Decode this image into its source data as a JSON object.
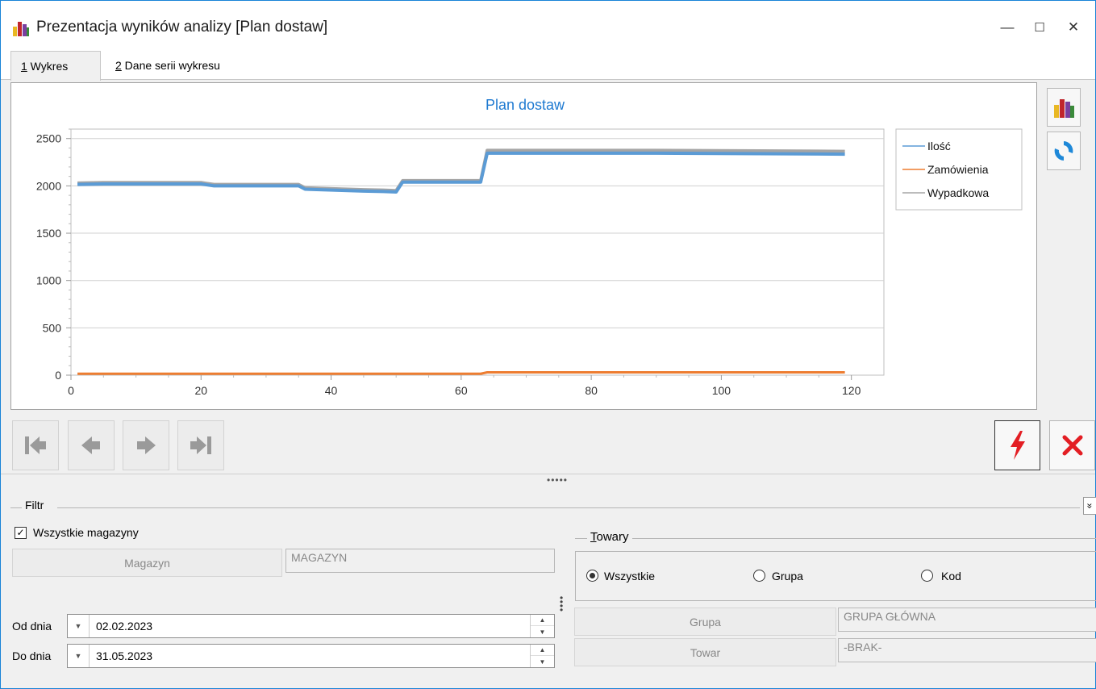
{
  "window": {
    "title": "Prezentacja wyników analizy [Plan dostaw]",
    "minimize_glyph": "—",
    "maximize_glyph": "☐",
    "close_glyph": "✕"
  },
  "tabs": [
    {
      "key": "1",
      "label": " Wykres",
      "active": true
    },
    {
      "key": "2",
      "label": " Dane serii wykresu",
      "active": false
    }
  ],
  "side_buttons": [
    {
      "name": "chart-type-icon"
    },
    {
      "name": "refresh-icon"
    }
  ],
  "nav_buttons": [
    "first-icon",
    "prev-icon",
    "next-icon",
    "last-icon"
  ],
  "action_buttons": [
    "run-icon",
    "cancel-icon"
  ],
  "filter": {
    "label": "Filtr",
    "collapse_glyph": "»",
    "all_warehouses": {
      "label": "Wszystkie magazyny",
      "checked": true
    },
    "magazyn_button": "Magazyn",
    "magazyn_value": "MAGAZYN",
    "od_label": "Od dnia",
    "od_value": "02.02.2023",
    "do_label": "Do dnia",
    "do_value": "31.05.2023",
    "towary": {
      "title_key": "T",
      "title_rest": "owary",
      "options": [
        {
          "label": "Wszystkie",
          "selected": true
        },
        {
          "label": "Grupa",
          "selected": false
        },
        {
          "label": "Kod",
          "selected": false
        }
      ],
      "grupa_button": "Grupa",
      "grupa_value": "GRUPA GŁÓWNA",
      "towar_button": "Towar",
      "towar_value": "-BRAK-"
    }
  },
  "colors": {
    "ilosc": "#5b9bd5",
    "zamowienia": "#ed7d31",
    "wypadkowa": "#a5a5a5",
    "title": "#1f7ad1",
    "accent_red": "#e31e24"
  },
  "chart_data": {
    "type": "line",
    "title": "Plan dostaw",
    "xlim": [
      0,
      125
    ],
    "ylim": [
      0,
      2600
    ],
    "xticks": [
      0,
      20,
      40,
      60,
      80,
      100,
      120
    ],
    "yticks": [
      0,
      500,
      1000,
      1500,
      2000,
      2500
    ],
    "grid": true,
    "legend": "top-right",
    "series": [
      {
        "name": "Ilość",
        "color": "#5b9bd5",
        "x": [
          1,
          5,
          20,
          22,
          35,
          36,
          45,
          48,
          50,
          51,
          63,
          64,
          90,
          119
        ],
        "y": [
          2015,
          2020,
          2020,
          2000,
          2000,
          1965,
          1945,
          1940,
          1935,
          2040,
          2040,
          2345,
          2345,
          2335
        ]
      },
      {
        "name": "Zamówienia",
        "color": "#ed7d31",
        "x": [
          1,
          63,
          64,
          119
        ],
        "y": [
          15,
          15,
          30,
          30
        ]
      },
      {
        "name": "Wypadkowa",
        "color": "#a5a5a5",
        "x": [
          1,
          5,
          20,
          22,
          35,
          36,
          45,
          48,
          50,
          51,
          63,
          64,
          90,
          119
        ],
        "y": [
          2030,
          2035,
          2035,
          2015,
          2015,
          1980,
          1960,
          1955,
          1950,
          2055,
          2055,
          2375,
          2375,
          2365
        ]
      }
    ]
  }
}
